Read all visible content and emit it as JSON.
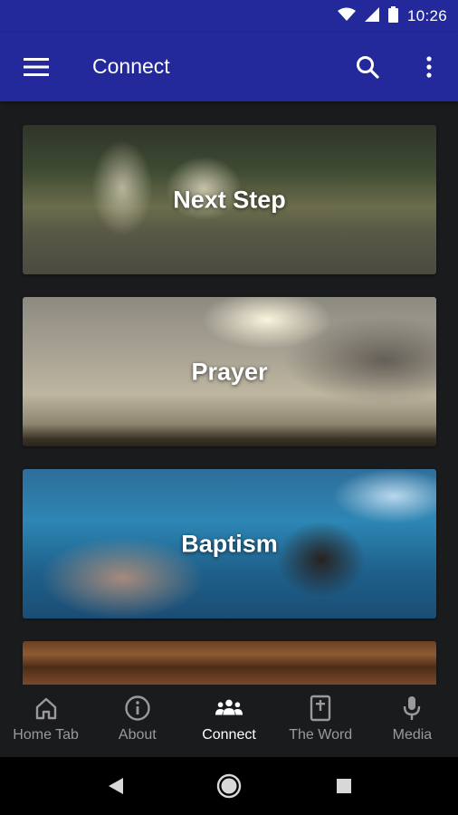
{
  "status_bar": {
    "time": "10:26"
  },
  "app_bar": {
    "title": "Connect"
  },
  "cards": [
    {
      "label": "Next Step"
    },
    {
      "label": "Prayer"
    },
    {
      "label": "Baptism"
    }
  ],
  "bottom_nav": {
    "items": [
      {
        "label": "Home Tab",
        "icon": "home-icon",
        "active": false
      },
      {
        "label": "About",
        "icon": "info-icon",
        "active": false
      },
      {
        "label": "Connect",
        "icon": "group-icon",
        "active": true
      },
      {
        "label": "The Word",
        "icon": "bible-icon",
        "active": false
      },
      {
        "label": "Media",
        "icon": "microphone-icon",
        "active": false
      }
    ]
  },
  "colors": {
    "app_bar": "#23289a",
    "background": "#1a1b1d",
    "nav_inactive": "#9a9a9c",
    "nav_active": "#ffffff"
  }
}
